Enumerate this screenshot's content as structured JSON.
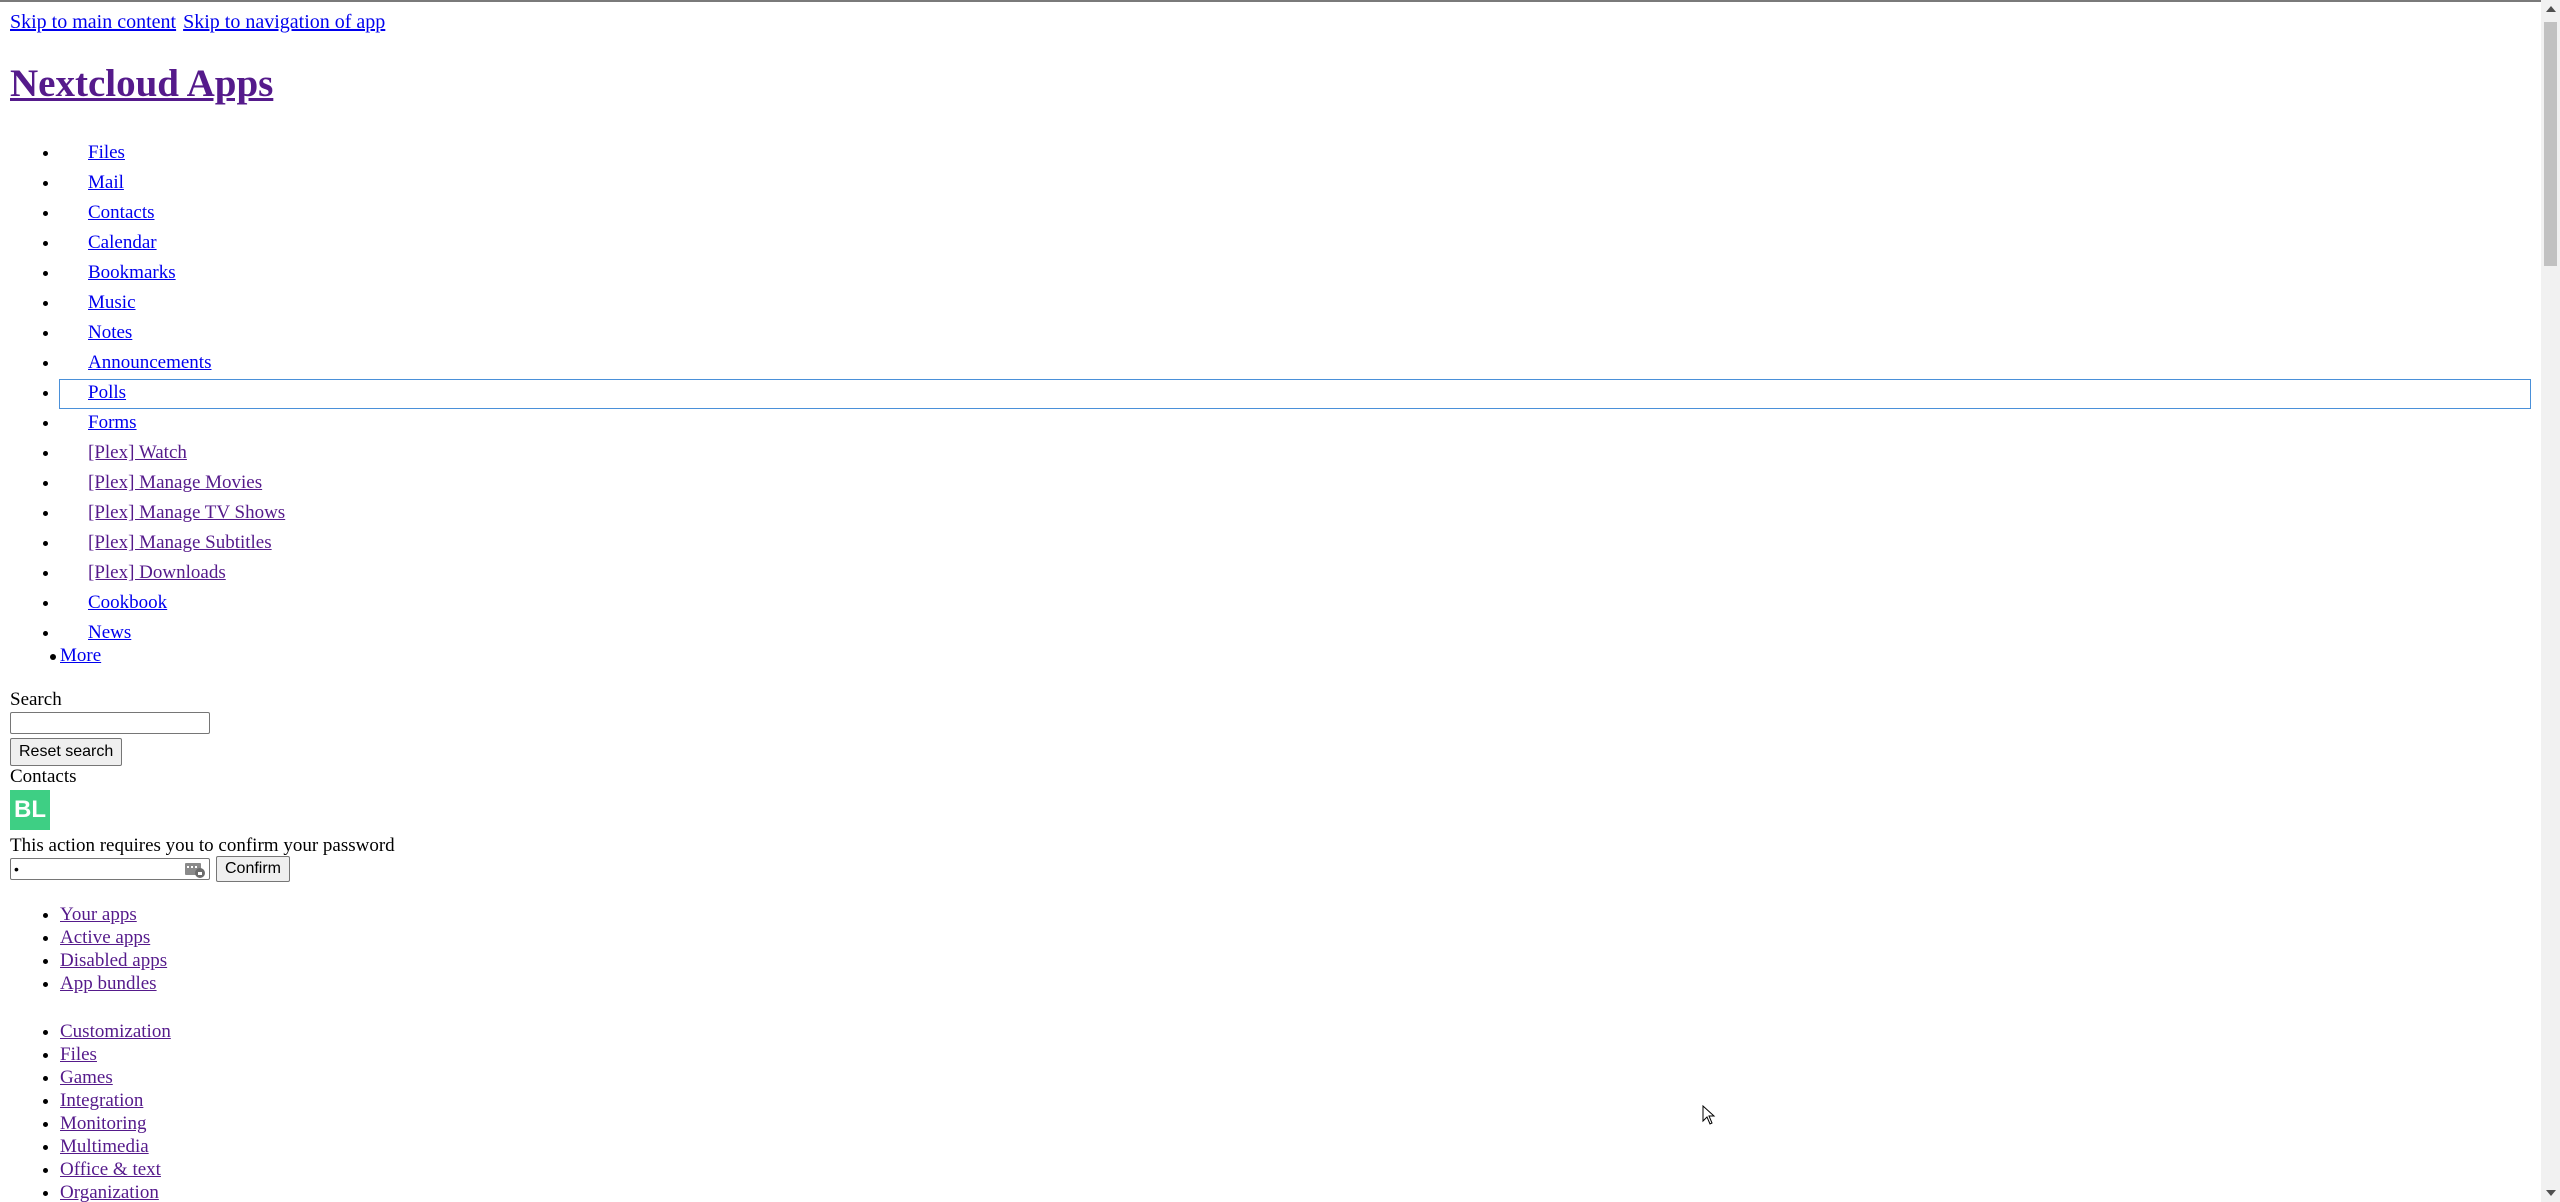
{
  "skip_links": {
    "main": "Skip to main content",
    "nav": "Skip to navigation of app"
  },
  "app_title": "Nextcloud Apps",
  "app_nav": [
    {
      "label": " Files"
    },
    {
      "label": " Mail"
    },
    {
      "label": " Contacts"
    },
    {
      "label": " Calendar"
    },
    {
      "label": " Bookmarks"
    },
    {
      "label": " Music"
    },
    {
      "label": " Notes"
    },
    {
      "label": " Announcements"
    },
    {
      "label": " Polls"
    },
    {
      "label": " Forms"
    },
    {
      "label": " [Plex] Watch"
    },
    {
      "label": " [Plex] Manage Movies"
    },
    {
      "label": " [Plex] Manage TV Shows"
    },
    {
      "label": " [Plex] Manage Subtitles"
    },
    {
      "label": " [Plex] Downloads"
    },
    {
      "label": " Cookbook"
    },
    {
      "label": " News"
    }
  ],
  "more_label": "More",
  "search": {
    "label": "Search",
    "value": "",
    "reset_label": "Reset search"
  },
  "contacts": {
    "label": "Contacts",
    "avatar_initials": "BL",
    "avatar_color": "#3ecf84"
  },
  "password_confirm": {
    "message": "This action requires you to confirm your password",
    "value": "•",
    "confirm_label": "Confirm"
  },
  "filters": [
    {
      "label": "Your apps"
    },
    {
      "label": "Active apps"
    },
    {
      "label": "Disabled apps"
    },
    {
      "label": "App bundles"
    }
  ],
  "categories": [
    {
      "label": "Customization"
    },
    {
      "label": "Files"
    },
    {
      "label": "Games"
    },
    {
      "label": "Integration"
    },
    {
      "label": "Monitoring"
    },
    {
      "label": "Multimedia"
    },
    {
      "label": "Office & text"
    },
    {
      "label": "Organization"
    }
  ],
  "colors": {
    "link": "#0000ee",
    "visited_link": "#551a8b",
    "focus_outline": "#4a90d9"
  }
}
